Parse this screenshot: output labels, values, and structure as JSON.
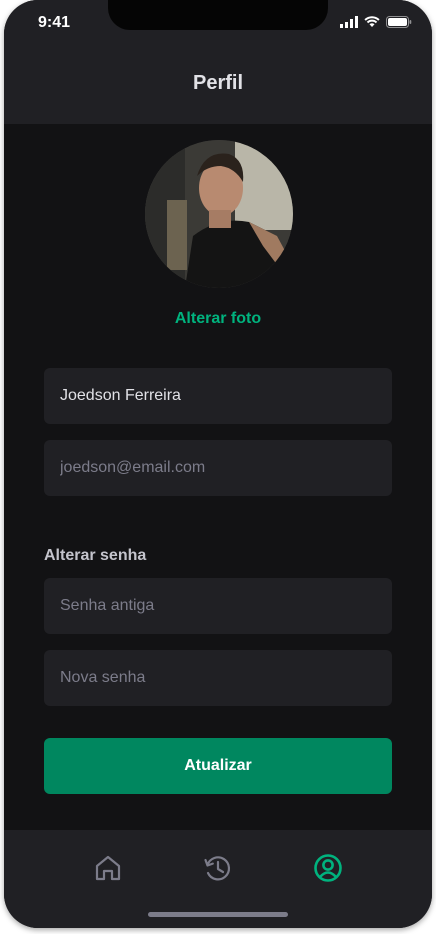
{
  "status_bar": {
    "time": "9:41"
  },
  "header": {
    "title": "Perfil"
  },
  "profile": {
    "change_photo_label": "Alterar foto",
    "name_value": "Joedson Ferreira",
    "email_placeholder": "joedson@email.com"
  },
  "password": {
    "section_label": "Alterar senha",
    "old_placeholder": "Senha antiga",
    "new_placeholder": "Nova senha"
  },
  "actions": {
    "update_label": "Atualizar"
  },
  "tabbar": {
    "items": [
      {
        "icon": "home-icon",
        "active": false
      },
      {
        "icon": "history-icon",
        "active": false
      },
      {
        "icon": "user-circle-icon",
        "active": true
      }
    ]
  },
  "colors": {
    "accent": "#00B37E",
    "button": "#00875F",
    "background": "#121214",
    "surface": "#202024",
    "inactive_icon": "#7C7C8A"
  }
}
